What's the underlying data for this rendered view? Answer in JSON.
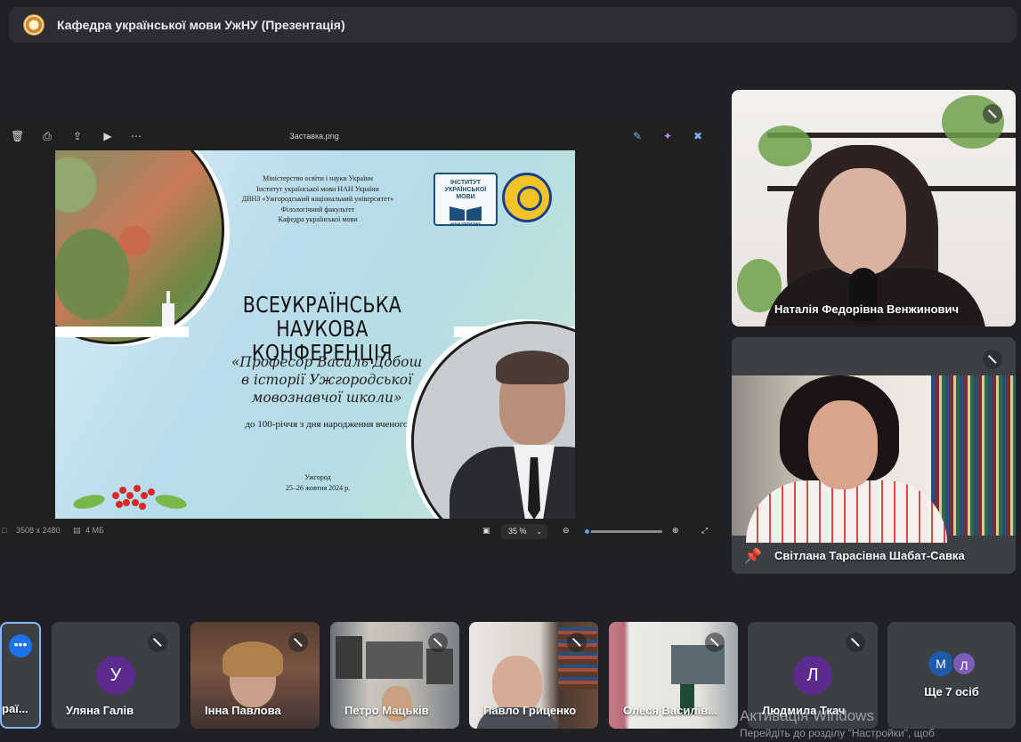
{
  "meeting": {
    "title": "Кафедра української мови УжНУ (Презентація)"
  },
  "viewer": {
    "filename": "Заставка.png",
    "dimensions": "3508 x 2480",
    "filesize": "4 МБ",
    "zoom": "35 %",
    "zoom_level_percent": 35,
    "toolbar_left_icons": [
      "trash-icon",
      "print-icon",
      "share-icon",
      "slideshow-icon",
      "more-icon"
    ],
    "toolbar_right_icons": [
      "edit-image-icon",
      "ai-icon",
      "video-off-icon"
    ]
  },
  "slide": {
    "header_lines": [
      "Міністерство освіти і науки України",
      "Інститут української мови НАН України",
      "ДВНЗ «Ужгородський національний університет»",
      "Філологічний факультет",
      "Кафедра української мови"
    ],
    "emblem_text": "ІНСТИТУТ УКРАЇНСЬКОЇ МОВИ",
    "emblem_subtext": "НАН УКРАЇНИ",
    "title_line1": "ВСЕУКРАЇНСЬКА",
    "title_line2": "НАУКОВА КОНФЕРЕНЦІЯ",
    "subtitle_line1": "«Професор Василь Добош",
    "subtitle_line2": "в історії Ужгородської",
    "subtitle_line3": "мовознавчої школи»",
    "anniversary": "до 100-річчя з дня народження вченого",
    "city": "Ужгород",
    "dates": "25–26 жовтня 2024 р."
  },
  "participants_side": [
    {
      "name": "Наталія Федорівна Венжинович",
      "mic": "off"
    },
    {
      "name": "Світлана Тарасівна Шабат-Савка",
      "mic": "off",
      "pinned": true
    }
  ],
  "participants_bottom": [
    {
      "name": "раї...",
      "mic": "on"
    },
    {
      "name": "Уляна Галів",
      "initial": "У",
      "avatar_color": "#5b2c8e",
      "mic": "off"
    },
    {
      "name": "Інна Павлова",
      "mic": "off"
    },
    {
      "name": "Петро Мацьків",
      "mic": "off"
    },
    {
      "name": "Павло Гриценко",
      "mic": "off"
    },
    {
      "name": "Олеся Василів...",
      "mic": "off"
    },
    {
      "name": "Людмила Ткач",
      "initial": "Л",
      "avatar_color": "#5b2c8e",
      "mic": "off"
    }
  ],
  "more_people": {
    "label": "Ще 7 осіб",
    "initials": [
      "М",
      "Л"
    ],
    "colors": [
      "#1e5aa8",
      "#7c5cb8"
    ]
  },
  "watermark": {
    "line1": "Активація Windows",
    "line2": "Перейдіть до розділу \"Настройки\", щоб"
  },
  "colors": {
    "background": "#202124",
    "tile": "#3c4043",
    "accent": "#1a73e8"
  }
}
